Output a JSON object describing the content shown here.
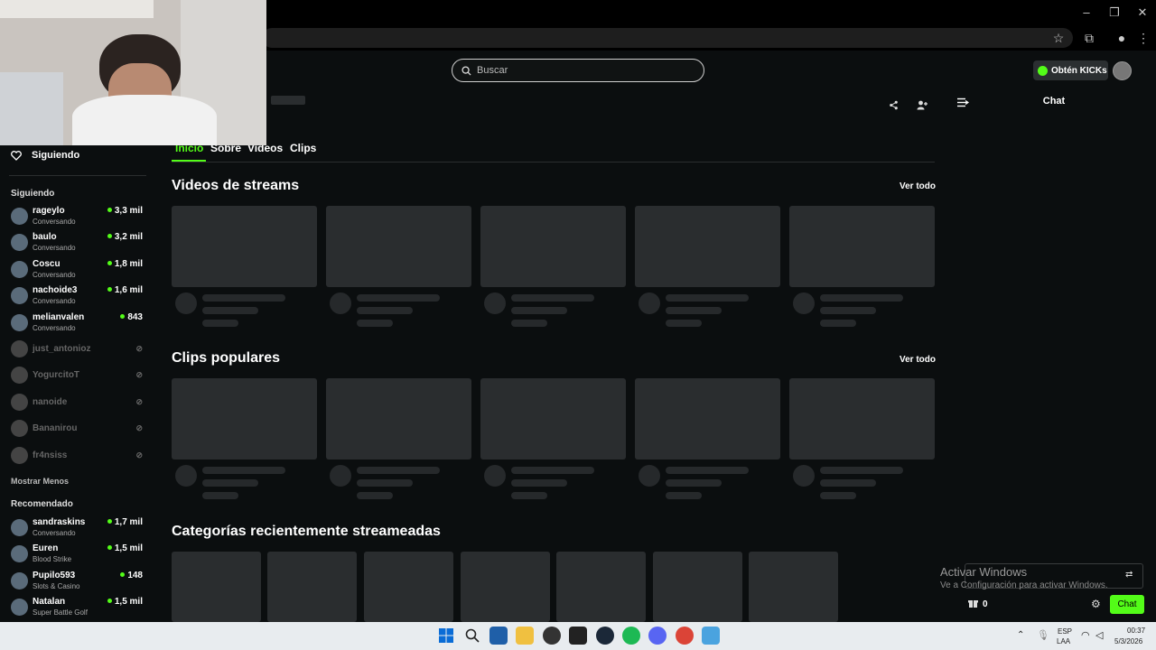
{
  "search": {
    "placeholder": "Buscar"
  },
  "header": {
    "kicks_label": "Obtén KICKs"
  },
  "tabs": [
    "Inicio",
    "Sobre",
    "Videos",
    "Clips"
  ],
  "sidebar": {
    "following_title": "Siguiendo",
    "following_heading": "Siguiendo",
    "following": [
      {
        "name": "rageylo",
        "sub": "Conversando",
        "viewers": "3,3 mil",
        "live": true
      },
      {
        "name": "baulo",
        "sub": "Conversando",
        "viewers": "3,2 mil",
        "live": true
      },
      {
        "name": "Coscu",
        "sub": "Conversando",
        "viewers": "1,8 mil",
        "live": true
      },
      {
        "name": "nachoide3",
        "sub": "Conversando",
        "viewers": "1,6 mil",
        "live": true
      },
      {
        "name": "melianvalen",
        "sub": "Conversando",
        "viewers": "843",
        "live": true
      },
      {
        "name": "just_antonioz",
        "live": false
      },
      {
        "name": "YogurcitoT",
        "live": false
      },
      {
        "name": "nanoide",
        "live": false
      },
      {
        "name": "Bananirou",
        "live": false
      },
      {
        "name": "fr4nsiss",
        "live": false
      }
    ],
    "show_less": "Mostrar Menos",
    "recommended_heading": "Recomendado",
    "recommended": [
      {
        "name": "sandraskins",
        "sub": "Conversando",
        "viewers": "1,7 mil"
      },
      {
        "name": "Euren",
        "sub": "Blood Strike",
        "viewers": "1,5 mil"
      },
      {
        "name": "Pupilo593",
        "sub": "Slots & Casino",
        "viewers": "148"
      },
      {
        "name": "Natalan",
        "sub": "Super Battle Golf",
        "viewers": "1,5 mil"
      }
    ]
  },
  "sections": {
    "videos_title": "Videos de streams",
    "clips_title": "Clips populares",
    "categories_title": "Categorías recientemente streameadas",
    "see_all": "Ver todo"
  },
  "chat": {
    "title": "Chat",
    "send_label": "Chat",
    "kicks_count": "0"
  },
  "watermark": {
    "line1": "Activar Windows",
    "line2": "Ve a Configuración para activar Windows."
  },
  "taskbar": {
    "lang1": "ESP",
    "lang2": "LAA",
    "time": "00:37",
    "date": "5/3/2026"
  },
  "colors": {
    "accent": "#53fc18",
    "background": "#0b0e0f",
    "skeleton": "#2a2d2f"
  },
  "icons": [
    "search-icon",
    "heart-icon",
    "share-icon",
    "add-friend-icon",
    "collapse-chat-icon",
    "settings-icon",
    "gift-icon",
    "star-icon",
    "extensions-icon",
    "menu-dots-icon",
    "windows-start-icon"
  ]
}
